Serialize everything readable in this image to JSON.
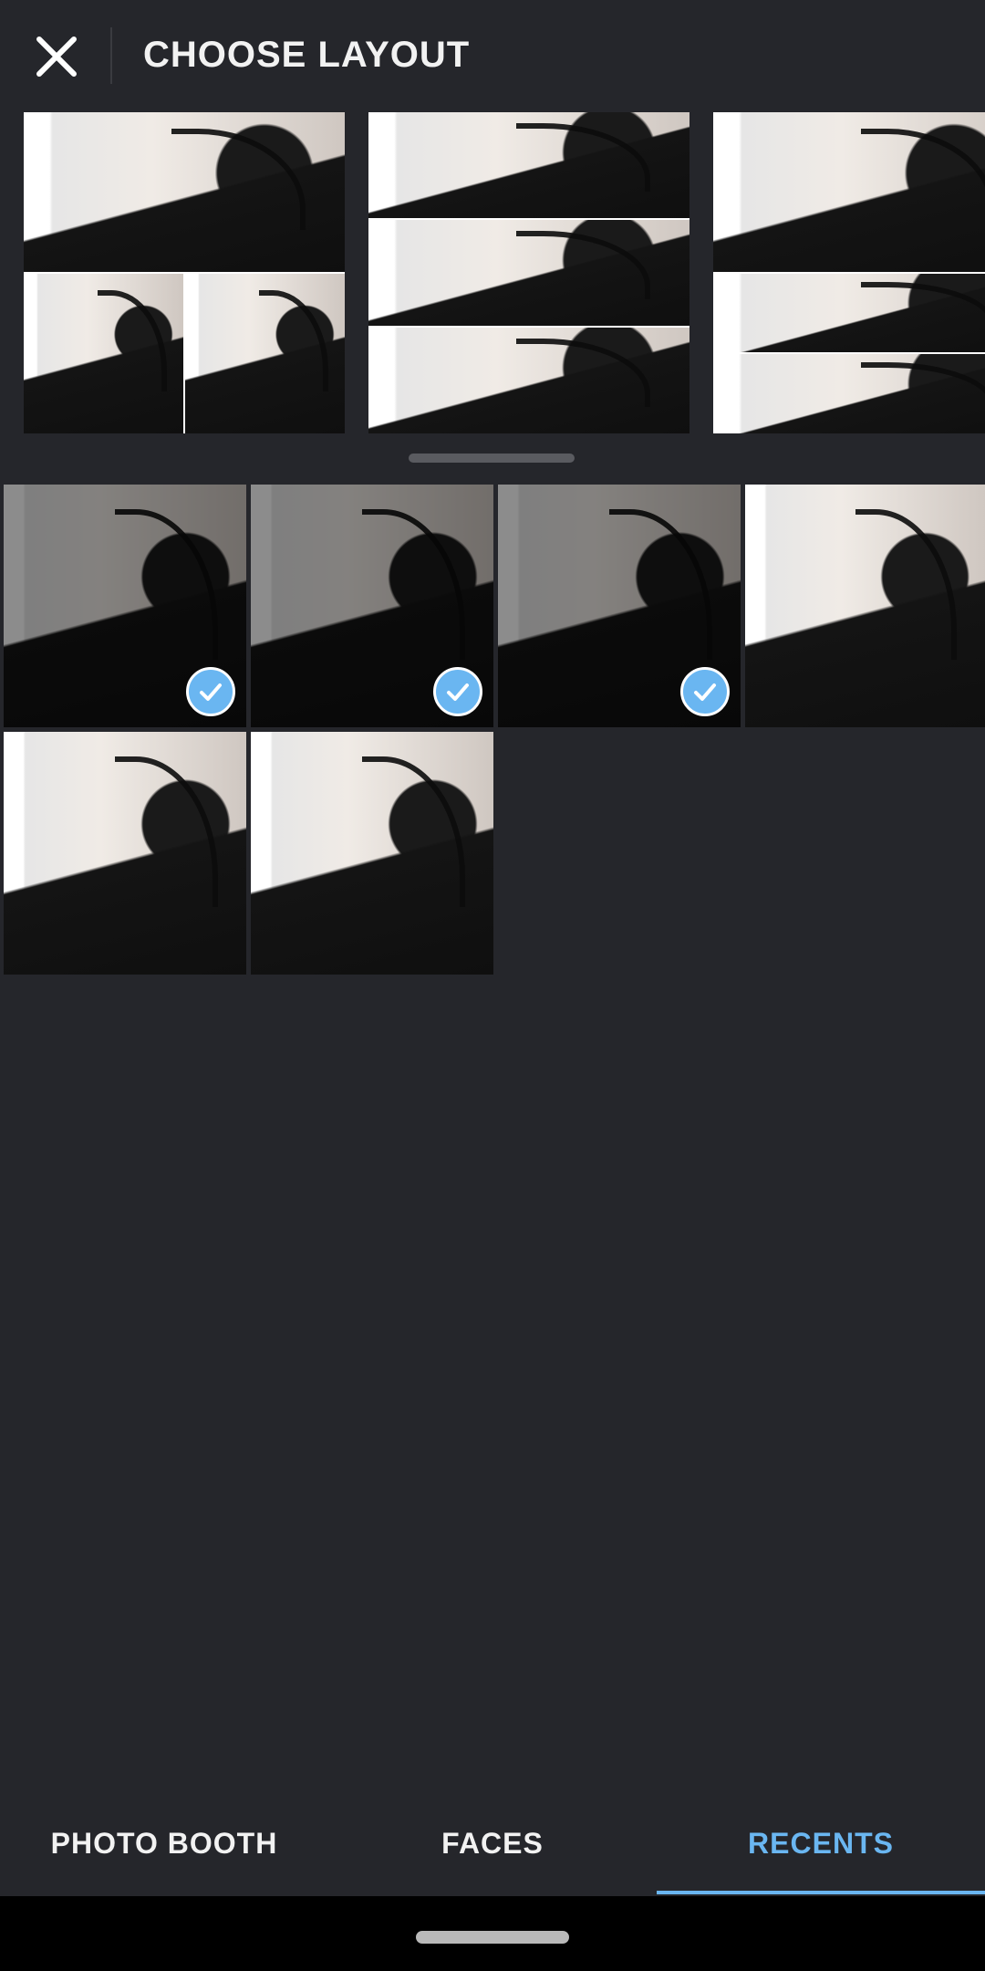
{
  "header": {
    "title": "CHOOSE LAYOUT",
    "close_icon": "close-icon"
  },
  "layouts": [
    {
      "name": "one-top-two-bottom"
    },
    {
      "name": "three-stacked"
    },
    {
      "name": "one-top-two-stacked"
    }
  ],
  "photos": [
    {
      "selected": true
    },
    {
      "selected": true
    },
    {
      "selected": true
    },
    {
      "selected": false
    },
    {
      "selected": false
    },
    {
      "selected": false
    }
  ],
  "tabs": {
    "photo_booth": "PHOTO BOOTH",
    "faces": "FACES",
    "recents": "RECENTS",
    "active": "recents"
  },
  "colors": {
    "background": "#25262b",
    "accent": "#6ab6f1",
    "nav_bar": "#000000"
  }
}
